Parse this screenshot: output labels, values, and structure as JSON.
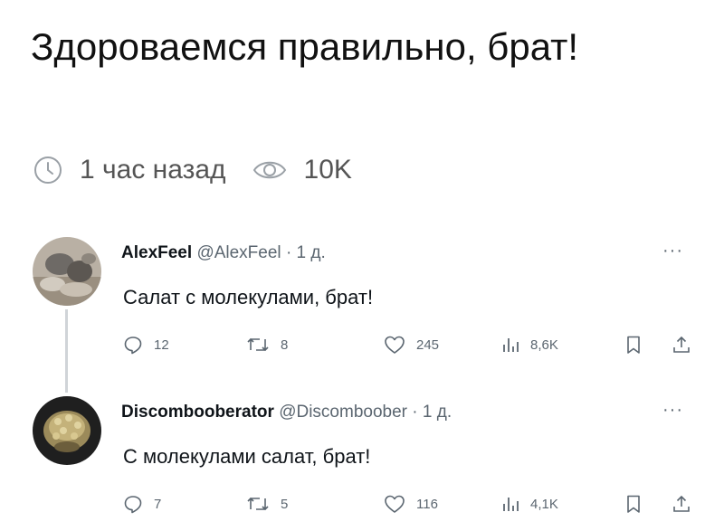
{
  "post": {
    "title": "Здороваемся правильно, брат!",
    "time": "1 час назад",
    "views": "10K"
  },
  "tweets": [
    {
      "name": "AlexFeel",
      "handle": "@AlexFeel",
      "dot": "·",
      "time": "1 д.",
      "more": "···",
      "text": "Салат с молекулами, брат!",
      "replies": "12",
      "retweets": "8",
      "likes": "245",
      "views": "8,6K"
    },
    {
      "name": "Discombooberator",
      "handle": "@Discomboober",
      "dot": "·",
      "time": "1 д.",
      "more": "···",
      "text": "С молекулами салат, брат!",
      "replies": "7",
      "retweets": "5",
      "likes": "116",
      "views": "4,1K"
    }
  ],
  "icons": {
    "meta": [
      "clock-icon",
      "eye-icon"
    ],
    "actions": [
      "reply-icon",
      "retweet-icon",
      "like-icon",
      "views-icon",
      "bookmark-icon",
      "share-icon"
    ]
  },
  "colors": {
    "text": "#0f1419",
    "muted": "#5b6670",
    "thread_line": "#d0d4d8"
  }
}
